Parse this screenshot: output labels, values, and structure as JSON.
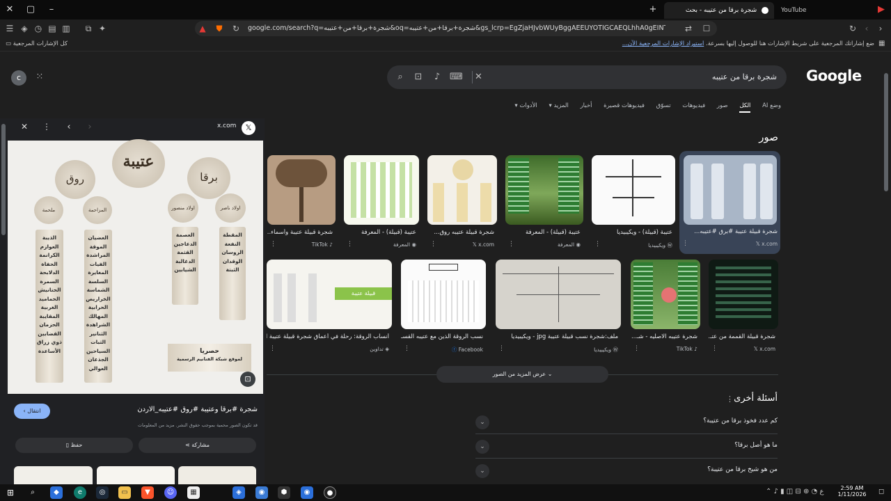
{
  "titlebar": {
    "tab_active": "شجرة برقا من عتيبه - بحث Google",
    "tab_other": "YouTube",
    "new_tab": "+",
    "close_tab": "×",
    "minimize": "–",
    "maximize": "▢",
    "close": "✕"
  },
  "toolbar": {
    "url": "google.com/search?q=شجرة+برقا+من+عتيبه&oq=شجرة+برقا+من+عتيبه&gs_lcrp=EgZjaHJvbWUyBggAEEUYOTIGCAEQLhhA0gEINTYxN2owajGoAgiwA..."
  },
  "bookmarks": {
    "all_bookmarks": "كل الإشارات المرجعية",
    "hint": "ضع إشاراتك المرجعية على شريط الإشارات هنا للوصول إليها بسرعة.",
    "import_link": "استيراد الإشارات المرجعية الآن..."
  },
  "google": {
    "logo": "Google",
    "query": "شجرة برقا من عتيبه",
    "avatar_letter": "c",
    "filters": [
      "وضع AI",
      "الكل",
      "صور",
      "فيديوهات",
      "تسوّق",
      "فيديوهات قصيرة",
      "أخبار",
      "المزيد",
      "الأدوات"
    ],
    "active_filter": "الكل",
    "images_heading": "صور",
    "row1": [
      {
        "caption": "شجرة قبيلة عتيبة #برق #عتيبه...",
        "source": "x.com"
      },
      {
        "caption": "عتيبة (قبيلة) - ويكيبيديا",
        "source": "ويكيبيديا"
      },
      {
        "caption": "عتيبة (قبيلة) - المعرفة",
        "source": "المعرفة"
      },
      {
        "caption": "شجرة قبيلة عتيبه روق...",
        "source": "x.com"
      },
      {
        "caption": "عتيبة (قبيلة) - المعرفة",
        "source": "المعرفة"
      },
      {
        "caption": "شجرة قبيلة عتيبة وأسماء...",
        "source": "TikTok"
      }
    ],
    "row2": [
      {
        "caption": "شجرة قبيلة القممة من عتـ...",
        "source": "x.com"
      },
      {
        "caption": "شجرة عتيبه الاصليه - شـ...",
        "source": "TikTok"
      },
      {
        "caption": "ملف:شجرة نسب قبيلة عتيبة jpg - ويكيبيديا",
        "source": "ويكيبيديا"
      },
      {
        "caption": "نسب الروقة الذين مع عتيبه القسـ...",
        "source": "Facebook"
      },
      {
        "caption": "أنساب الروقة: رحلة في أعماق شجرة قبيلة عتيبة ا...",
        "source": "تداوين"
      }
    ],
    "show_more": "عرض المزيد من الصور",
    "paa_heading": "أسئلة أخرى",
    "questions": [
      "كم عدد فخوذ برقا من عتيبة؟",
      "ما هو أصل برقا؟",
      "من هو شيخ برقا من عتيبة؟"
    ]
  },
  "panel": {
    "source": "x.com",
    "title": "شجرة #برقا وعتيبة #روق #عتيبه_الاردن",
    "note": "قد تكون الصور محمية بموجب حقوق النشر. مزيد من المعلومات",
    "share": "مشاركة",
    "save": "حفظ",
    "visit": "انتقال",
    "infographic": {
      "top": "عتيبة",
      "left_group": "روق",
      "right_group": "برقا",
      "c1": "ملحمة",
      "c2": "المزاحمة",
      "c3": "اولاد منصور",
      "c4": "اولاد ناصر",
      "p1": "الذيبة\nالعوازم\nالكرانمة\nالحفاة\nالدلابحة\nالسمرة\nالحتانيش\nالحماميد\nالغربية\nالمقايبة\nالحزمان\nالقضابين\nذوي زراق\nالأساعدة",
      "p2": "العضيان\nالموقة\nالمراشدة\nالفيات\nالمغايرة\nالسلسة\nالشماسة\nالخراريص\nالحرابية\nالمهالك\nالشراهدة\nالثنانير\nالثبات\nالسياحين\nالجذعان\nالعوالي",
      "p3": "العصمة\nالدعاجين\nالقثمة\nالدغالبة\nالشيابين",
      "p4": "المقطة\nالنفعة\nالروسان\nالوقدان\nالثبتة",
      "banner_1": "حصريا",
      "banner_2": "لموقع شبكة القنانيم الرسمية"
    }
  },
  "taskbar": {
    "time": "2:59 AM",
    "date": "1/11/2026"
  },
  "colors": {
    "accent": "#8ab4f8",
    "selected_card": "#394457",
    "visit_btn": "#8ab4f8"
  }
}
